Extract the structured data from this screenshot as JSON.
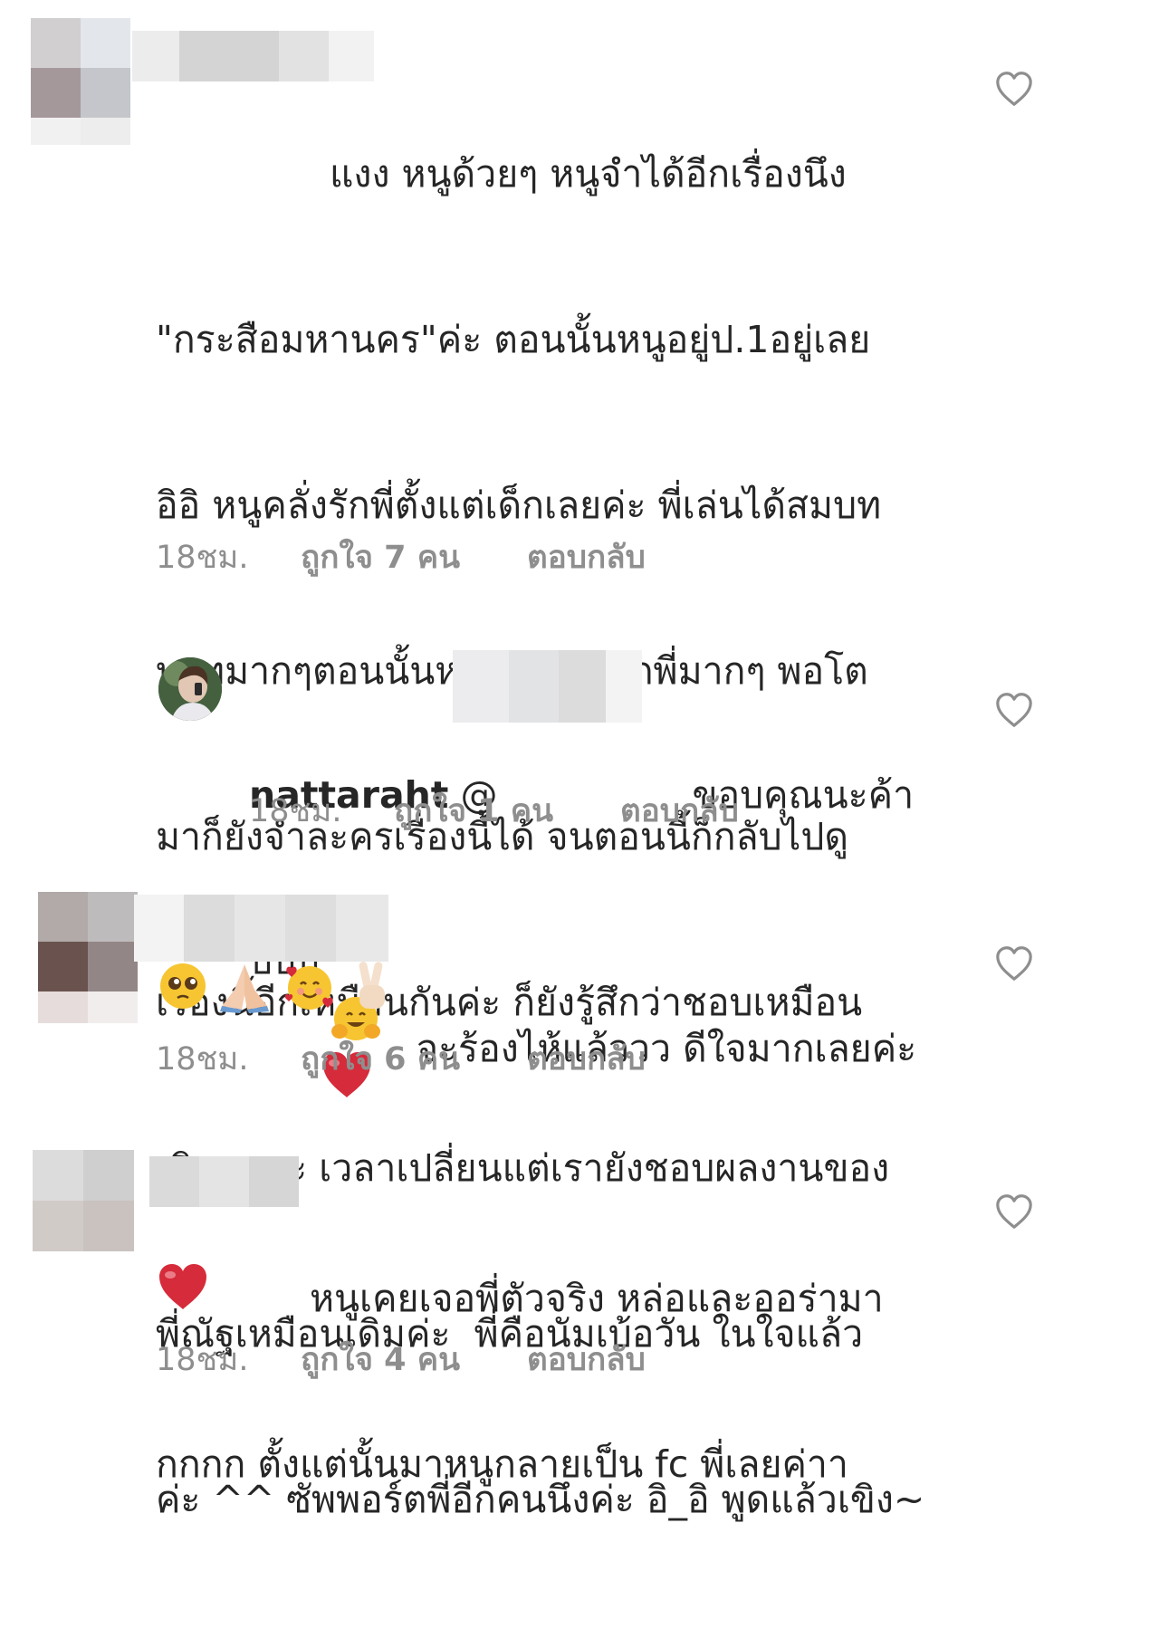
{
  "comments": [
    {
      "lines": [
        "แงง หนูด้วยๆ หนูจำได้อีกเรื่องนึง",
        "\"กระสือมหานคร\"ค่ะ ตอนนั้นหนูอยู่ป.1อยู่เลย",
        "อิอิ หนูคลั่งรักพี่ตั้งแต่เด็กเลยค่ะ พี่เล่นได้สมบท",
        "บาทมากๆตอนนั้นหนูอินสุดๆ รักพี่มากๆ พอโต",
        "มาก็ยังจำละครเรื่องนี้ได้ จนตอนนี้ก็กลับไปดู",
        "เรื่องนี้อีกเหมือนกันค่ะ ก็ยังรู้สึกว่าชอบเหมือน",
        "เดิมนะคะ เวลาเปลี่ยนแต่เรายังชอบผลงานของ",
        "พี่ณัฐเหมือนเดิมค่ะ  พี่คือนัมเบ้อวัน ในใจแล้ว",
        "ค่ะ ^^ ซัพพอร์ตพี่อีกคนนึงค่ะ อิ_อิ พูดแล้วเขิง~"
      ],
      "time": "18ชม.",
      "likes": "ถูกใจ 7 คน",
      "reply": "ตอบกลับ"
    },
    {
      "username": "nattaraht",
      "mention_prefix": "@",
      "line1_suffix": "ขอบคุณนะค้า",
      "line2": "บบบ",
      "emojis": [
        "hugging-face-emoji",
        "red-heart-emoji"
      ],
      "time": "18ชม.",
      "likes": "ถูกใจ 1 คน",
      "reply": "ตอบกลับ"
    },
    {
      "line1": "จะร้องไห้แล้ววว ดีใจมากเลยค่ะ",
      "emojis": [
        "pleading-face-emoji",
        "folded-hands-emoji",
        "smiling-face-with-hearts-emoji",
        "victory-hand-emoji"
      ],
      "time": "18ชม.",
      "likes": "ถูกใจ 6 คน",
      "reply": "ตอบกลับ"
    },
    {
      "lines": [
        "หนูเคยเจอพี่ตัวจริง หล่อและออร่ามา",
        "กกกก ตั้งแต่นั้นมาหนูกลายเป็น fc พี่เลยค่าา"
      ],
      "emojis": [
        "red-heart-emoji"
      ],
      "time": "18ชม.",
      "likes": "ถูกใจ 4 คน",
      "reply": "ตอบกลับ"
    }
  ],
  "colors": {
    "text": "#262626",
    "meta": "#8e8e8e",
    "heart_outline": "#8e8e8e",
    "emoji_heart": "#d62b3a"
  }
}
